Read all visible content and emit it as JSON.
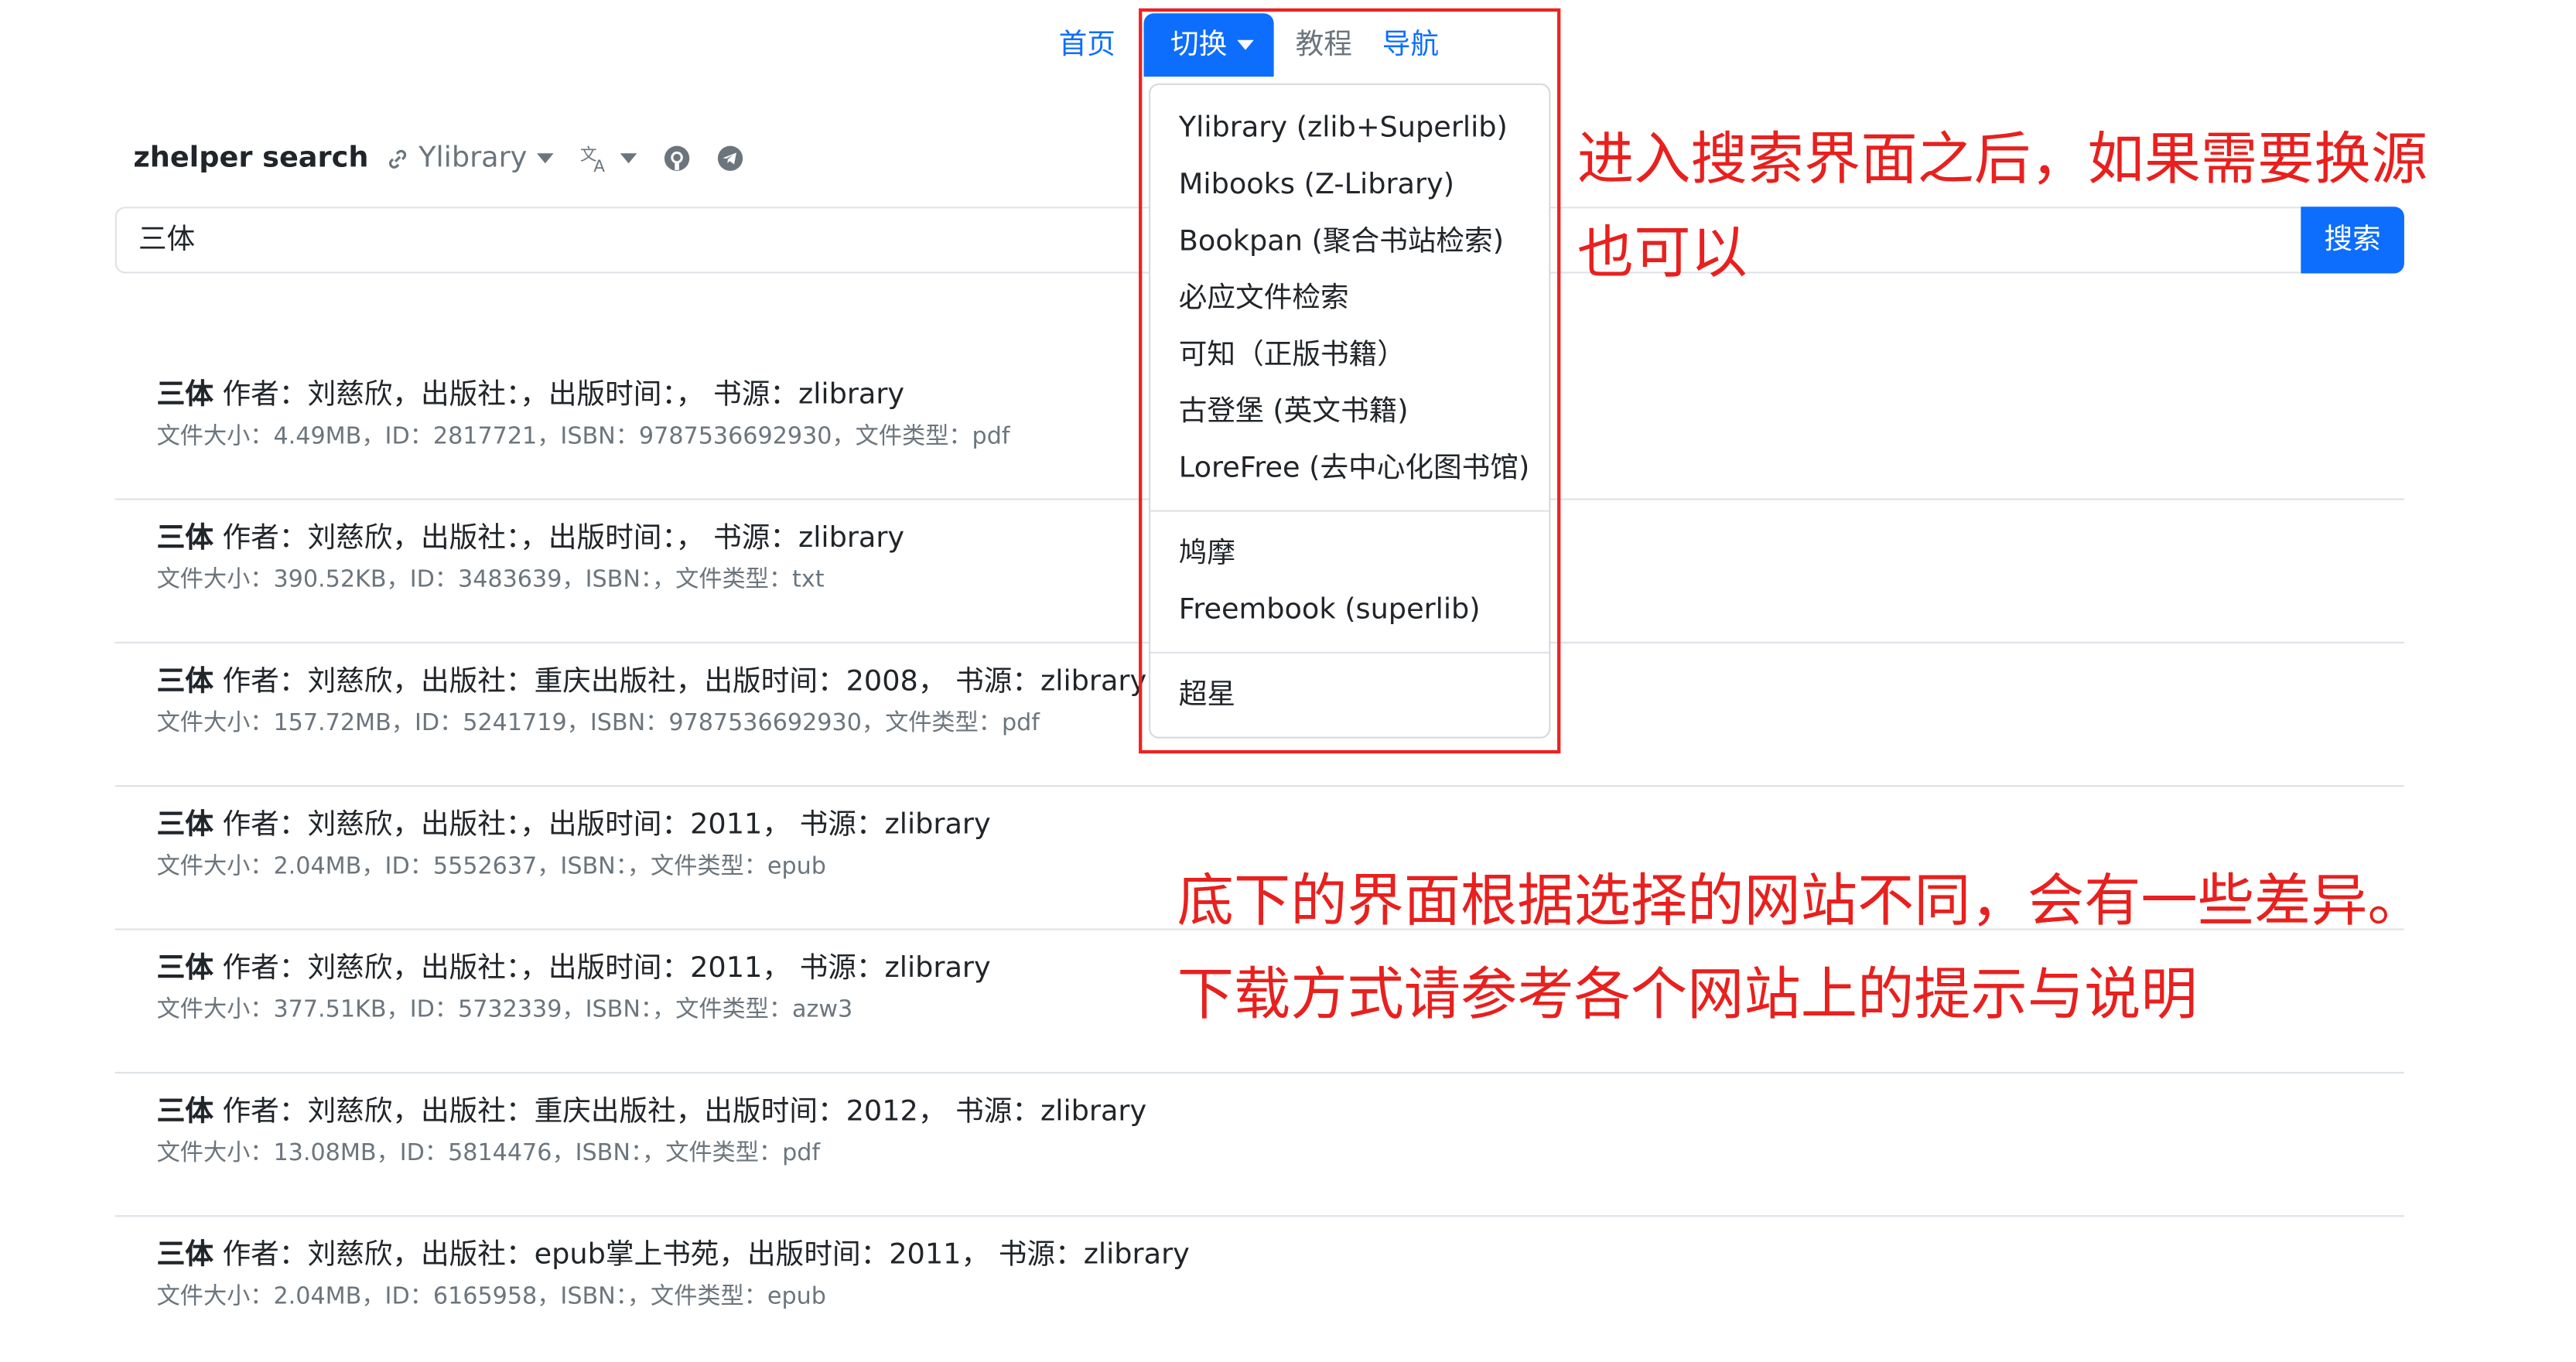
{
  "nav": {
    "home": "首页",
    "switch": "切换",
    "tutorial": "教程",
    "guide": "导航"
  },
  "brand": "zhelper search",
  "source_selector": "Ylibrary",
  "icons": {
    "link": "link-icon",
    "translate": "translate-icon",
    "github": "github-icon",
    "telegram": "telegram-icon"
  },
  "search": {
    "query": "三体",
    "button": "搜索"
  },
  "dropdown": {
    "group1": [
      "Ylibrary (zlib+Superlib)",
      "Mibooks (Z-Library)",
      "Bookpan (聚合书站检索)",
      "必应文件检索",
      "可知（正版书籍）",
      "古登堡 (英文书籍)",
      "LoreFree (去中心化图书馆)"
    ],
    "group2": [
      "鸠摩",
      "Freembook (superlib)"
    ],
    "group3": [
      "超星"
    ]
  },
  "results": [
    {
      "title": "三体",
      "meta": " 作者：刘慈欣，出版社：，出版时间：， 书源：zlibrary",
      "detail": "文件大小：4.49MB，ID：2817721，ISBN：9787536692930，文件类型：pdf"
    },
    {
      "title": "三体",
      "meta": " 作者：刘慈欣，出版社：，出版时间：， 书源：zlibrary",
      "detail": "文件大小：390.52KB，ID：3483639，ISBN：，文件类型：txt"
    },
    {
      "title": "三体",
      "meta": " 作者：刘慈欣，出版社：重庆出版社，出版时间：2008， 书源：zlibrary",
      "detail": "文件大小：157.72MB，ID：5241719，ISBN：9787536692930，文件类型：pdf"
    },
    {
      "title": "三体",
      "meta": " 作者：刘慈欣，出版社：，出版时间：2011， 书源：zlibrary",
      "detail": "文件大小：2.04MB，ID：5552637，ISBN：，文件类型：epub"
    },
    {
      "title": "三体",
      "meta": " 作者：刘慈欣，出版社：，出版时间：2011， 书源：zlibrary",
      "detail": "文件大小：377.51KB，ID：5732339，ISBN：，文件类型：azw3"
    },
    {
      "title": "三体",
      "meta": " 作者：刘慈欣，出版社：重庆出版社，出版时间：2012， 书源：zlibrary",
      "detail": "文件大小：13.08MB，ID：5814476，ISBN：，文件类型：pdf"
    },
    {
      "title": "三体",
      "meta": " 作者：刘慈欣，出版社：epub掌上书苑，出版时间：2011， 书源：zlibrary",
      "detail": "文件大小：2.04MB，ID：6165958，ISBN：，文件类型：epub"
    }
  ],
  "annotations": {
    "top_line1": "进入搜索界面之后，如果需要换源",
    "top_line2": "也可以",
    "bottom_line1": "底下的界面根据选择的网站不同，会有一些差异。",
    "bottom_line2": "下载方式请参考各个网站上的提示与说明"
  },
  "colors": {
    "primary": "#0d6efd",
    "muted": "#6c757d",
    "annotation": "#e8201e",
    "border": "#dee2e6"
  }
}
